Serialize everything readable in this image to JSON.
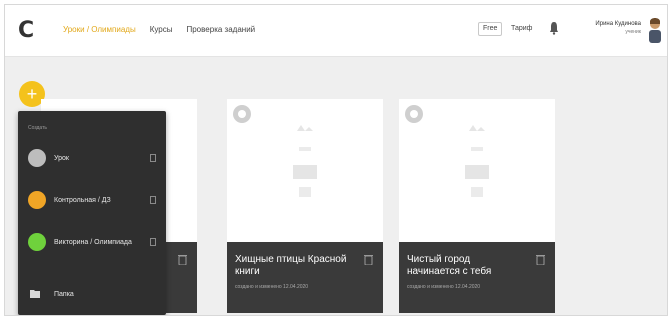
{
  "header": {
    "logo": "С",
    "nav": [
      "Уроки / Олимпиады",
      "Курсы",
      "Проверка заданий"
    ],
    "tariff_badge": "Free",
    "tariff_label": "Тариф",
    "user_name": "Ирина Кудинова",
    "user_role": "ученик"
  },
  "add_button": "+",
  "menu": {
    "heading": "Создать",
    "items": [
      {
        "label": "Урок",
        "color": "#bdbdbd"
      },
      {
        "label": "Контрольная / ДЗ",
        "color": "#f0a526"
      },
      {
        "label": "Викторина / Олимпиада",
        "color": "#6fd13c"
      }
    ],
    "folder_label": "Папка"
  },
  "cards": [
    {
      "title": "",
      "sub": ""
    },
    {
      "title": "Хищные птицы Красной книги",
      "sub": "создано и изменено 12.04.2020"
    },
    {
      "title": "Чистый город начинается с тебя",
      "sub": "создано и изменено 12.04.2020"
    }
  ],
  "colors": {
    "accent": "#f4c21c",
    "card_footer": "#3a3a3a",
    "menu_bg": "#2f2f2f"
  }
}
